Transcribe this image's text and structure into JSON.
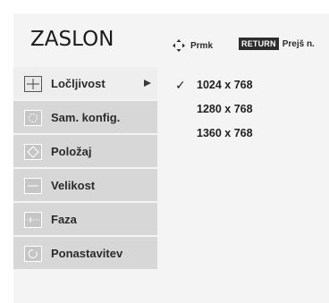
{
  "header": {
    "title": "ZASLON",
    "nav_hint": "Prmk",
    "return_badge": "RETURN",
    "return_hint": "Prejš n."
  },
  "menu": {
    "items": [
      {
        "label": "Ločljivost",
        "icon": "crosshair-icon",
        "selected": true
      },
      {
        "label": "Sam. konfig.",
        "icon": "auto-config-icon",
        "selected": false
      },
      {
        "label": "Položaj",
        "icon": "position-icon",
        "selected": false
      },
      {
        "label": "Velikost",
        "icon": "size-icon",
        "selected": false
      },
      {
        "label": "Faza",
        "icon": "phase-icon",
        "selected": false
      },
      {
        "label": "Ponastavitev",
        "icon": "reset-icon",
        "selected": false
      }
    ]
  },
  "resolution_options": [
    {
      "value": "1024 x 768",
      "checked": true
    },
    {
      "value": "1280 x 768",
      "checked": false
    },
    {
      "value": "1360 x 768",
      "checked": false
    }
  ],
  "colors": {
    "panel_bg": "#f4f4f4",
    "item_bg": "#d7d7d7",
    "selected_bg": "#eeeeee"
  }
}
